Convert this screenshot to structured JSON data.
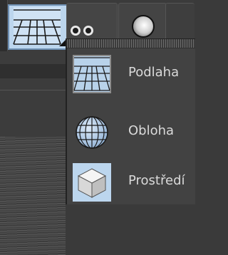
{
  "toolbar": {
    "buttons": [
      {
        "name": "floor-tool-button",
        "icon": "floor-grid-icon",
        "active": true
      },
      {
        "name": "camera-tool-button",
        "icon": "binoculars-icon",
        "active": false
      },
      {
        "name": "sphere-tool-button",
        "icon": "sphere-icon",
        "active": false
      }
    ]
  },
  "menu": {
    "items": [
      {
        "label": "Podlaha",
        "icon": "floor-grid-icon"
      },
      {
        "label": "Obloha",
        "icon": "sky-globe-icon"
      },
      {
        "label": "Prostředí",
        "icon": "environment-cube-icon"
      }
    ]
  },
  "colors": {
    "accent": "#bcd6ee",
    "accent_border": "#6e8fb2",
    "background": "#3a3a3a",
    "menu_bg": "#424242",
    "text": "#dadada"
  }
}
